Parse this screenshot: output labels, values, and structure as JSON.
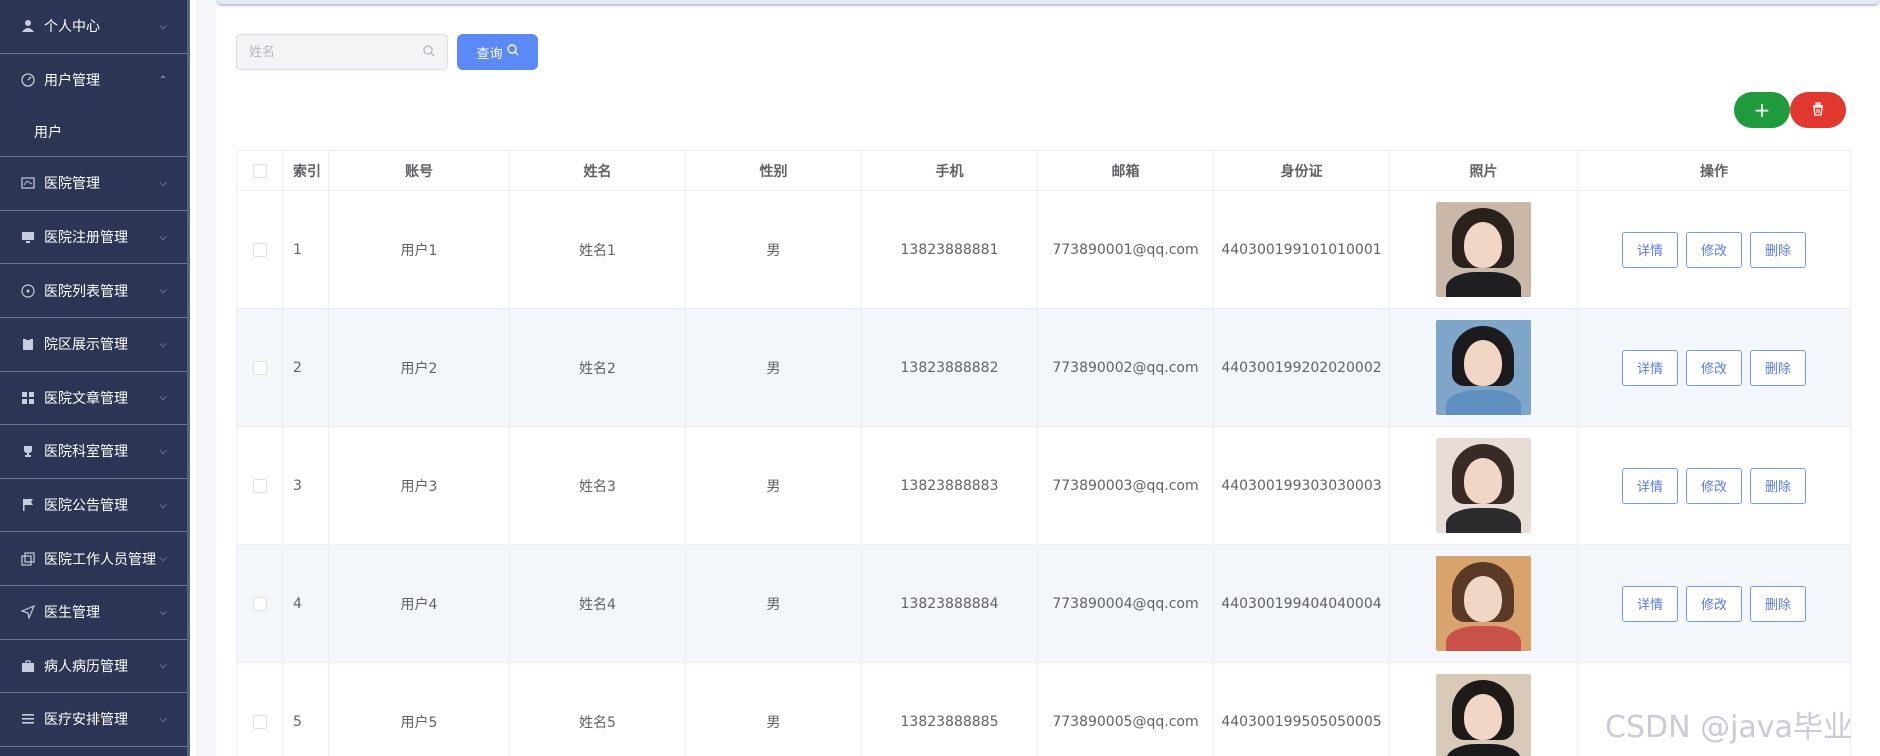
{
  "sidebar": {
    "items": [
      {
        "label": "个人中心",
        "icon": "user-icon"
      },
      {
        "label": "用户管理",
        "icon": "gauge-icon"
      },
      {
        "label": "医院管理",
        "icon": "chart-icon"
      },
      {
        "label": "医院注册管理",
        "icon": "monitor-icon"
      },
      {
        "label": "医院列表管理",
        "icon": "compass-icon"
      },
      {
        "label": "院区展示管理",
        "icon": "clipboard-icon"
      },
      {
        "label": "医院文章管理",
        "icon": "grid-icon"
      },
      {
        "label": "医院科室管理",
        "icon": "trophy-icon"
      },
      {
        "label": "医院公告管理",
        "icon": "flag-icon"
      },
      {
        "label": "医院工作人员管理",
        "icon": "copy-icon"
      },
      {
        "label": "医生管理",
        "icon": "send-icon"
      },
      {
        "label": "病人病历管理",
        "icon": "briefcase-icon"
      },
      {
        "label": "医疗安排管理",
        "icon": "list-icon"
      }
    ],
    "sub_item": "用户"
  },
  "search": {
    "placeholder": "姓名",
    "button_label": "查询"
  },
  "actions": {
    "add_label": "+"
  },
  "table": {
    "headers": [
      "索引",
      "账号",
      "姓名",
      "性别",
      "手机",
      "邮箱",
      "身份证",
      "照片",
      "操作"
    ],
    "rows": [
      {
        "index": "1",
        "account": "用户1",
        "name": "姓名1",
        "gender": "男",
        "phone": "13823888881",
        "email": "773890001@qq.com",
        "idcard": "440300199101010001"
      },
      {
        "index": "2",
        "account": "用户2",
        "name": "姓名2",
        "gender": "男",
        "phone": "13823888882",
        "email": "773890002@qq.com",
        "idcard": "440300199202020002"
      },
      {
        "index": "3",
        "account": "用户3",
        "name": "姓名3",
        "gender": "男",
        "phone": "13823888883",
        "email": "773890003@qq.com",
        "idcard": "440300199303030003"
      },
      {
        "index": "4",
        "account": "用户4",
        "name": "姓名4",
        "gender": "男",
        "phone": "13823888884",
        "email": "773890004@qq.com",
        "idcard": "440300199404040004"
      },
      {
        "index": "5",
        "account": "用户5",
        "name": "姓名5",
        "gender": "男",
        "phone": "13823888885",
        "email": "773890005@qq.com",
        "idcard": "440300199505050005"
      }
    ],
    "op_labels": {
      "detail": "详情",
      "edit": "修改",
      "delete": "删除"
    }
  },
  "watermark": "CSDN @java毕业",
  "colors": {
    "sidebar_bg": "#2c3553",
    "primary": "#5b8af7",
    "add_green": "#1f9b3e",
    "delete_red": "#e0372e",
    "row_stripe": "#f3f6fb"
  }
}
